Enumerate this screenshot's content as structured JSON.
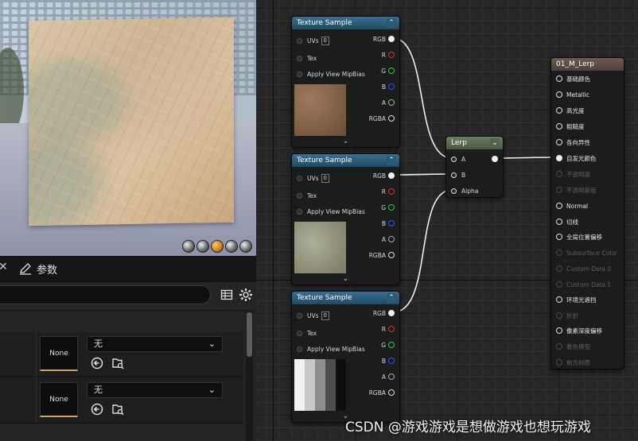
{
  "details": {
    "tab_label": "参数",
    "rows": [
      {
        "thumb_label": "None",
        "combo_value": "无"
      },
      {
        "thumb_label": "None",
        "combo_value": "无"
      }
    ]
  },
  "graph": {
    "texture_nodes": [
      {
        "title": "Texture Sample",
        "uvs_label": "UVs",
        "uvs_value": "0",
        "tex_label": "Tex",
        "mip_label": "Apply View MipBias",
        "outputs": [
          "RGB",
          "R",
          "G",
          "B",
          "A",
          "RGBA"
        ]
      },
      {
        "title": "Texture Sample",
        "uvs_label": "UVs",
        "uvs_value": "0",
        "tex_label": "Tex",
        "mip_label": "Apply View MipBias",
        "outputs": [
          "RGB",
          "R",
          "G",
          "B",
          "A",
          "RGBA"
        ]
      },
      {
        "title": "Texture Sample",
        "uvs_label": "UVs",
        "uvs_value": "0",
        "tex_label": "Tex",
        "mip_label": "Apply View MipBias",
        "outputs": [
          "RGB",
          "R",
          "G",
          "B",
          "A",
          "RGBA"
        ]
      }
    ],
    "lerp_node": {
      "title": "Lerp",
      "inputs": [
        "A",
        "B",
        "Alpha"
      ]
    },
    "material_node": {
      "title": "01_M_Lerp",
      "pins": [
        {
          "label": "基础颜色",
          "enabled": true
        },
        {
          "label": "Metallic",
          "enabled": true
        },
        {
          "label": "高光度",
          "enabled": true
        },
        {
          "label": "粗糙度",
          "enabled": true
        },
        {
          "label": "各向异性",
          "enabled": true
        },
        {
          "label": "自发光颜色",
          "enabled": true,
          "connected": true
        },
        {
          "label": "不透明度",
          "enabled": false
        },
        {
          "label": "不透明蒙版",
          "enabled": false
        },
        {
          "label": "Normal",
          "enabled": true
        },
        {
          "label": "切线",
          "enabled": true
        },
        {
          "label": "全局位置偏移",
          "enabled": true
        },
        {
          "label": "Subsurface Color",
          "enabled": false
        },
        {
          "label": "Custom Data 0",
          "enabled": false
        },
        {
          "label": "Custom Data 1",
          "enabled": false
        },
        {
          "label": "环境光遮挡",
          "enabled": true
        },
        {
          "label": "折射",
          "enabled": false
        },
        {
          "label": "像素深度偏移",
          "enabled": true
        },
        {
          "label": "着色模型",
          "enabled": false
        },
        {
          "label": "前方材质",
          "enabled": false
        }
      ]
    }
  },
  "watermark": "CSDN @游戏游戏是想做游戏也想玩游戏",
  "colors": {
    "pin_r": "#e03030",
    "pin_g": "#30d030",
    "pin_b": "#3050ff",
    "accent": "#d6a55c"
  }
}
